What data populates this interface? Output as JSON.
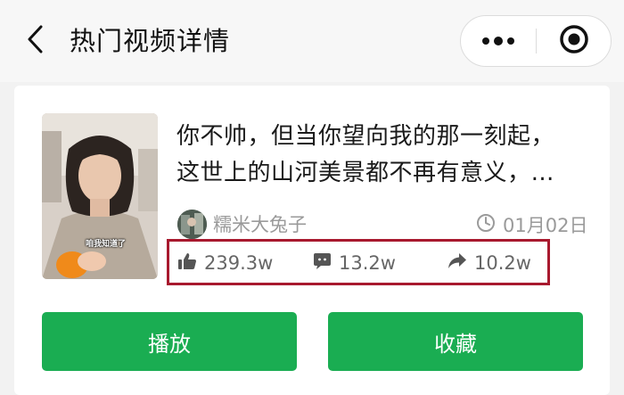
{
  "header": {
    "title": "热门视频详情",
    "back_icon": "chevron-left-icon",
    "menu_icon": "more-dots-icon",
    "close_icon": "target-close-icon"
  },
  "video": {
    "thumbnail_caption": "咱我知道了",
    "title": "你不帅，但当你望向我的那一刻起，这世上的山河美景都不再有意义，…",
    "author": "糯米大兔子",
    "date": "01月02日",
    "stats": {
      "likes": "239.3w",
      "comments": "13.2w",
      "shares": "10.2w"
    }
  },
  "actions": {
    "play_label": "播放",
    "favorite_label": "收藏"
  },
  "colors": {
    "primary_green": "#1aad52",
    "highlight_red": "#a8192e",
    "meta_gray": "#9a9a9a"
  }
}
